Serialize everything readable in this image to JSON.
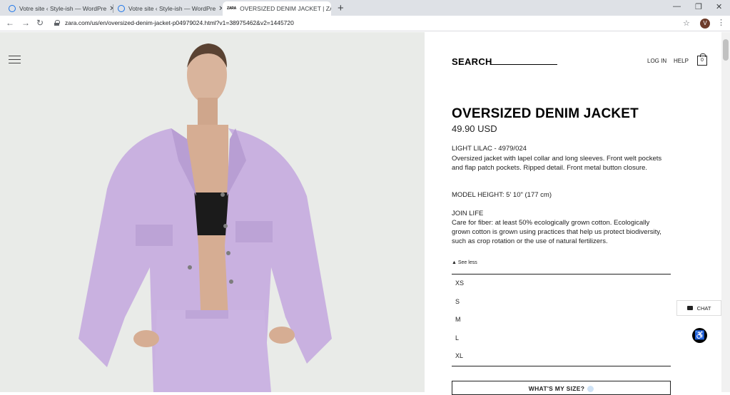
{
  "browser": {
    "tabs": [
      {
        "label": "Votre site ‹ Style-ish — WordPre"
      },
      {
        "label": "Votre site ‹ Style-ish — WordPre"
      },
      {
        "label": "OVERSIZED DENIM JACKET | ZAR",
        "favicon": "ZARA"
      }
    ],
    "url": "zara.com/us/en/oversized-denim-jacket-p04979024.html?v1=38975462&v2=1445720",
    "profile_initial": "V"
  },
  "header": {
    "search_label": "SEARCH",
    "login": "LOG IN",
    "help": "HELP",
    "bag_count": "0"
  },
  "product": {
    "name": "OVERSIZED DENIM JACKET",
    "price": "49.90 USD",
    "color_ref": "LIGHT LILAC - 4979/024",
    "description": "Oversized jacket with lapel collar and long sleeves. Front welt pockets and flap patch pockets. Ripped detail. Front metal button closure.",
    "model_height": "MODEL HEIGHT: 5' 10\" (177 cm)",
    "join_life_title": "JOIN LIFE",
    "join_life_text": "Care for fiber: at least 50% ecologically grown cotton. Ecologically grown cotton is grown using practices that help us protect biodiversity, such as crop rotation or the use of natural fertilizers.",
    "see_less": "See less",
    "sizes": [
      "XS",
      "S",
      "M",
      "L",
      "XL"
    ],
    "whats_my_size": "WHAT'S MY SIZE?"
  },
  "widgets": {
    "chat": "CHAT"
  },
  "colors": {
    "jacket": "#c9b1e0",
    "background_photo": "#e9ebe8"
  }
}
